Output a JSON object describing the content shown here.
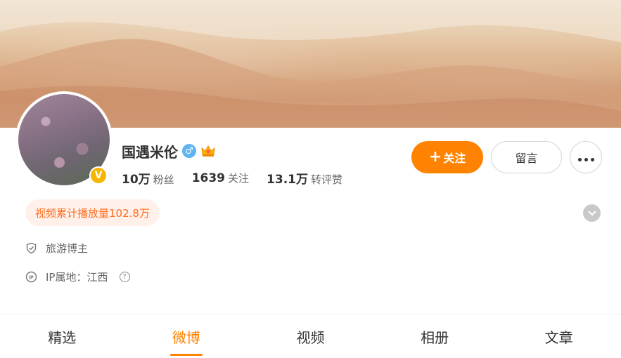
{
  "profile": {
    "name": "国遇米伦",
    "verified_mark": "V",
    "gender_symbol": "♂",
    "crown_icon": "crown-icon",
    "stats": [
      {
        "value": "10万",
        "label": "粉丝"
      },
      {
        "value": "1639",
        "label": "关注"
      },
      {
        "value": "13.1万",
        "label": "转评赞"
      }
    ],
    "video_badge": "视频累计播放量102.8万",
    "info": {
      "role": "旅游博主",
      "ip_label": "IP属地：",
      "ip_value": "江西",
      "help_symbol": "?"
    }
  },
  "actions": {
    "follow_plus": "+",
    "follow_label": "关注",
    "message_label": "留言"
  },
  "tabs": [
    {
      "label": "精选"
    },
    {
      "label": "微博"
    },
    {
      "label": "视频"
    },
    {
      "label": "相册"
    },
    {
      "label": "文章"
    }
  ],
  "active_tab": "微博",
  "colors": {
    "accent": "#ff8200",
    "badge_text": "#ff6b1a",
    "badge_bg": "#fff1ea",
    "verified": "#f7b500",
    "gender": "#5fb4f2"
  }
}
